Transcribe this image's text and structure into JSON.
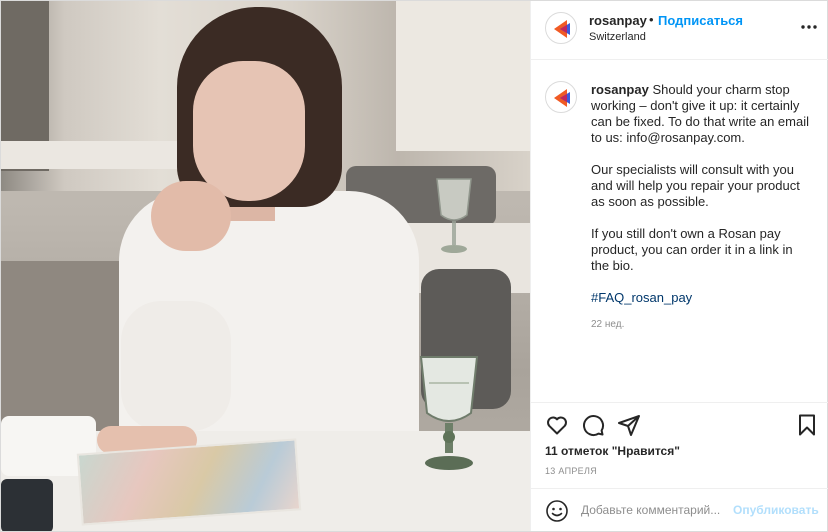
{
  "post": {
    "author": {
      "username": "rosanpay",
      "follow_label": "Подписаться",
      "separator": "•",
      "location": "Switzerland"
    },
    "caption": {
      "username": "rosanpay",
      "paragraphs": [
        "Should your charm stop working – don't give it up: it certainly can be fixed. To do that write an email to us: info@rosanpay.com.",
        "Our specialists will consult with you and will help you repair your product as soon as possible.",
        "If you still don't own a Rosan pay product, you can order it in a link in the bio."
      ],
      "hashtag": "#FAQ_rosan_pay",
      "age": "22 нед."
    },
    "likes_text": "11 отметок \"Нравится\"",
    "date": "13 АПРЕЛЯ",
    "comment_box": {
      "placeholder": "Добавьте комментарий...",
      "publish_label": "Опубликовать"
    },
    "icons": {
      "more": "more-options-icon",
      "like": "heart-icon",
      "comment": "comment-bubble-icon",
      "share": "paper-plane-icon",
      "save": "bookmark-icon",
      "emoji": "smiley-icon"
    },
    "colors": {
      "accent": "#0095f6",
      "publish_disabled": "#b2dffc",
      "hashtag": "#00376b",
      "muted": "#8e8e8e",
      "logo_orange": "#f15a24",
      "logo_blue": "#3b5bdb"
    }
  }
}
